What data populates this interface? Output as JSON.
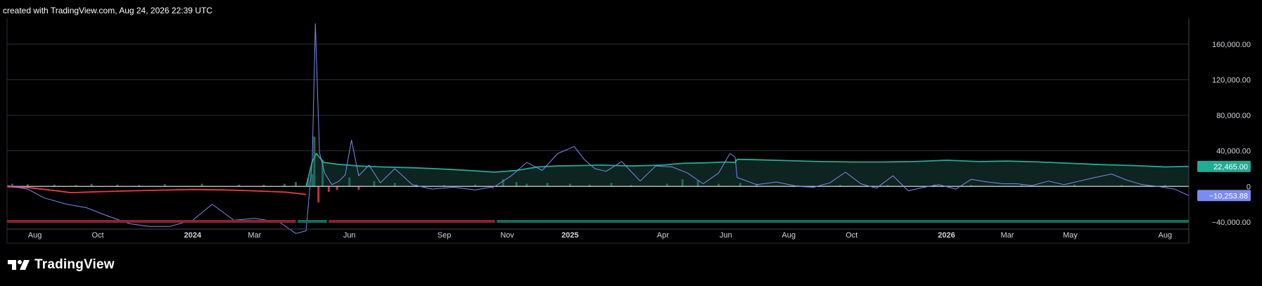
{
  "header": {
    "text": "created with TradingView.com, Aug 24, 2026 22:39 UTC"
  },
  "brand": {
    "name": "TradingView",
    "logo_icon": "tradingview-logo-icon"
  },
  "colors": {
    "background": "#000000",
    "grid": "#2a2e39",
    "zero_line": "#d1d4dc",
    "green": "#22ab94",
    "red": "#f23645",
    "blue": "#7b8bef",
    "green_fill": "#0f2a26",
    "bar_green": "#1f6b58",
    "bar_red": "#c2303a"
  },
  "chart_data": {
    "type": "line",
    "title": "",
    "x_tick_labels": [
      {
        "label": "Aug",
        "date": "2023-08-01"
      },
      {
        "label": "Oct",
        "date": "2023-10-01"
      },
      {
        "label": "2024",
        "date": "2024-01-01",
        "bold": true
      },
      {
        "label": "Mar",
        "date": "2024-03-01"
      },
      {
        "label": "Jun",
        "date": "2024-06-01"
      },
      {
        "label": "Sep",
        "date": "2024-09-01"
      },
      {
        "label": "Nov",
        "date": "2024-11-01"
      },
      {
        "label": "2025",
        "date": "2025-01-01",
        "bold": true
      },
      {
        "label": "Apr",
        "date": "2025-04-01"
      },
      {
        "label": "Jun",
        "date": "2025-06-01"
      },
      {
        "label": "Aug",
        "date": "2025-08-01"
      },
      {
        "label": "Oct",
        "date": "2025-10-01"
      },
      {
        "label": "2026",
        "date": "2026-01-01",
        "bold": true
      },
      {
        "label": "Mar",
        "date": "2026-03-01"
      },
      {
        "label": "May",
        "date": "2026-05-01"
      },
      {
        "label": "Aug",
        "date": "2026-08-01"
      }
    ],
    "y_ticks": [
      "160,000.00",
      "120,000.00",
      "80,000.00",
      "40,000.00",
      "0",
      "−40,000.00"
    ],
    "y_tick_values": [
      160000,
      120000,
      80000,
      40000,
      0,
      -40000
    ],
    "ylim": [
      -48000,
      186000
    ],
    "xlim": [
      "2023-07-05",
      "2026-08-24"
    ],
    "grid": true,
    "last_value_labels": [
      {
        "series": "green",
        "text": "22,465.00",
        "value": 22465
      },
      {
        "series": "blue",
        "text": "−10,253.88",
        "value": -10254
      }
    ],
    "series": [
      {
        "key": "red_line",
        "color": "red",
        "x": [
          "2023-07-05",
          "2023-07-25",
          "2023-08-15",
          "2023-09-05",
          "2023-10-01",
          "2023-11-01",
          "2023-12-01",
          "2024-01-01",
          "2024-02-01",
          "2024-03-01",
          "2024-04-01",
          "2024-04-20"
        ],
        "y": [
          -500,
          -1200,
          -4000,
          -7000,
          -6000,
          -5000,
          -4200,
          -3500,
          -4000,
          -5000,
          -6500,
          -9000
        ]
      },
      {
        "key": "green_line",
        "color": "green",
        "x": [
          "2024-04-20",
          "2024-04-26",
          "2024-04-30",
          "2024-05-07",
          "2024-05-20",
          "2024-06-10",
          "2024-07-01",
          "2024-08-01",
          "2024-09-01",
          "2024-10-01",
          "2024-10-20",
          "2024-11-10",
          "2024-12-01",
          "2024-12-20",
          "2025-01-10",
          "2025-02-01",
          "2025-03-01",
          "2025-04-01",
          "2025-04-20",
          "2025-05-10",
          "2025-06-01",
          "2025-06-10",
          "2025-06-12",
          "2025-07-01",
          "2025-08-01",
          "2025-09-01",
          "2025-10-01",
          "2025-11-01",
          "2025-12-01",
          "2026-01-01",
          "2026-02-01",
          "2026-03-01",
          "2026-04-01",
          "2026-05-01",
          "2026-06-01",
          "2026-07-01",
          "2026-08-01",
          "2026-08-24"
        ],
        "y": [
          0,
          28000,
          37000,
          27000,
          25000,
          23000,
          22000,
          21000,
          19500,
          17500,
          16000,
          18000,
          22000,
          23000,
          23500,
          24000,
          23000,
          24000,
          26000,
          26500,
          27500,
          27000,
          30500,
          30000,
          29000,
          28000,
          27500,
          27500,
          28000,
          29500,
          28000,
          28500,
          27500,
          26000,
          24500,
          23500,
          22000,
          22465
        ]
      },
      {
        "key": "blue_line",
        "color": "blue",
        "x": [
          "2023-07-05",
          "2023-07-25",
          "2023-08-10",
          "2023-09-01",
          "2023-09-20",
          "2023-10-10",
          "2023-11-01",
          "2023-11-20",
          "2023-12-10",
          "2023-12-25",
          "2024-01-01",
          "2024-01-20",
          "2024-02-10",
          "2024-03-01",
          "2024-03-25",
          "2024-04-10",
          "2024-04-20",
          "2024-04-26",
          "2024-04-29",
          "2024-05-03",
          "2024-05-08",
          "2024-05-15",
          "2024-05-22",
          "2024-05-28",
          "2024-06-03",
          "2024-06-10",
          "2024-06-20",
          "2024-07-01",
          "2024-07-15",
          "2024-08-01",
          "2024-08-20",
          "2024-09-10",
          "2024-10-01",
          "2024-10-20",
          "2024-11-05",
          "2024-11-20",
          "2024-12-05",
          "2024-12-20",
          "2025-01-05",
          "2025-01-15",
          "2025-01-25",
          "2025-02-05",
          "2025-02-20",
          "2025-03-10",
          "2025-03-25",
          "2025-04-10",
          "2025-04-25",
          "2025-05-10",
          "2025-05-25",
          "2025-06-05",
          "2025-06-10",
          "2025-06-12",
          "2025-07-01",
          "2025-07-20",
          "2025-08-10",
          "2025-08-25",
          "2025-09-10",
          "2025-09-25",
          "2025-10-10",
          "2025-10-25",
          "2025-11-10",
          "2025-11-25",
          "2025-12-10",
          "2025-12-25",
          "2026-01-10",
          "2026-01-25",
          "2026-02-10",
          "2026-02-25",
          "2026-03-10",
          "2026-03-25",
          "2026-04-10",
          "2026-04-25",
          "2026-05-10",
          "2026-05-25",
          "2026-06-10",
          "2026-06-25",
          "2026-07-10",
          "2026-07-25",
          "2026-08-10",
          "2026-08-24"
        ],
        "y": [
          1000,
          -3000,
          -13000,
          -20000,
          -24000,
          -33000,
          -42000,
          -45000,
          -45000,
          -40000,
          -38000,
          -20000,
          -38000,
          -36000,
          -40000,
          -53000,
          -50000,
          30000,
          183000,
          38000,
          15000,
          2000,
          6000,
          13000,
          52000,
          12000,
          24000,
          4000,
          20000,
          2000,
          -3000,
          -1000,
          -4000,
          0,
          12000,
          27000,
          18000,
          37000,
          45000,
          30000,
          20000,
          17000,
          28000,
          6000,
          23000,
          22000,
          15000,
          3000,
          15000,
          37000,
          33000,
          10000,
          2000,
          5000,
          0,
          -1000,
          4000,
          16000,
          3000,
          -2000,
          12000,
          -5000,
          -1000,
          2000,
          -3000,
          8000,
          5000,
          3000,
          3000,
          1000,
          6000,
          2000,
          6000,
          10000,
          14000,
          7000,
          2000,
          0,
          -3000,
          -10254
        ]
      }
    ],
    "volume_bars": {
      "x": [
        "2023-07-10",
        "2023-07-25",
        "2023-08-20",
        "2023-09-10",
        "2023-09-25",
        "2023-10-20",
        "2023-11-10",
        "2023-12-05",
        "2024-01-10",
        "2024-02-15",
        "2024-03-10",
        "2024-03-30",
        "2024-04-10",
        "2024-04-22",
        "2024-04-26",
        "2024-04-28",
        "2024-05-02",
        "2024-05-06",
        "2024-05-12",
        "2024-05-20",
        "2024-06-01",
        "2024-06-10",
        "2024-06-25",
        "2024-07-15",
        "2024-08-05",
        "2024-09-01",
        "2024-10-01",
        "2024-10-18",
        "2024-10-28",
        "2024-11-10",
        "2024-11-20",
        "2024-12-10",
        "2025-01-01",
        "2025-01-20",
        "2025-02-10",
        "2025-03-01",
        "2025-04-05",
        "2025-04-20",
        "2025-05-05",
        "2025-05-25",
        "2025-06-15",
        "2025-07-01",
        "2025-08-10",
        "2025-09-20",
        "2025-11-05",
        "2025-12-20",
        "2026-01-25",
        "2026-03-15",
        "2026-05-05",
        "2026-06-20",
        "2026-08-01"
      ],
      "y": [
        3000,
        2500,
        2000,
        1500,
        3000,
        2000,
        1500,
        2500,
        3000,
        2000,
        2000,
        3000,
        5000,
        9000,
        14000,
        56000,
        -18000,
        30000,
        -6000,
        -4000,
        10000,
        -4000,
        6000,
        4000,
        2000,
        1500,
        2000,
        -2000,
        8000,
        5000,
        3000,
        4000,
        3000,
        2000,
        4000,
        1500,
        3000,
        8000,
        7000,
        3000,
        4000,
        3000,
        1500,
        1500,
        1500,
        2000,
        1500,
        1500,
        2000,
        1500,
        1500
      ]
    },
    "segment_strip": [
      {
        "start": "2023-07-05",
        "end": "2024-04-10",
        "color": "red"
      },
      {
        "start": "2024-04-12",
        "end": "2024-05-10",
        "color": "green"
      },
      {
        "start": "2024-05-12",
        "end": "2024-10-20",
        "color": "red"
      },
      {
        "start": "2024-10-22",
        "end": "2026-08-24",
        "color": "green"
      }
    ]
  }
}
